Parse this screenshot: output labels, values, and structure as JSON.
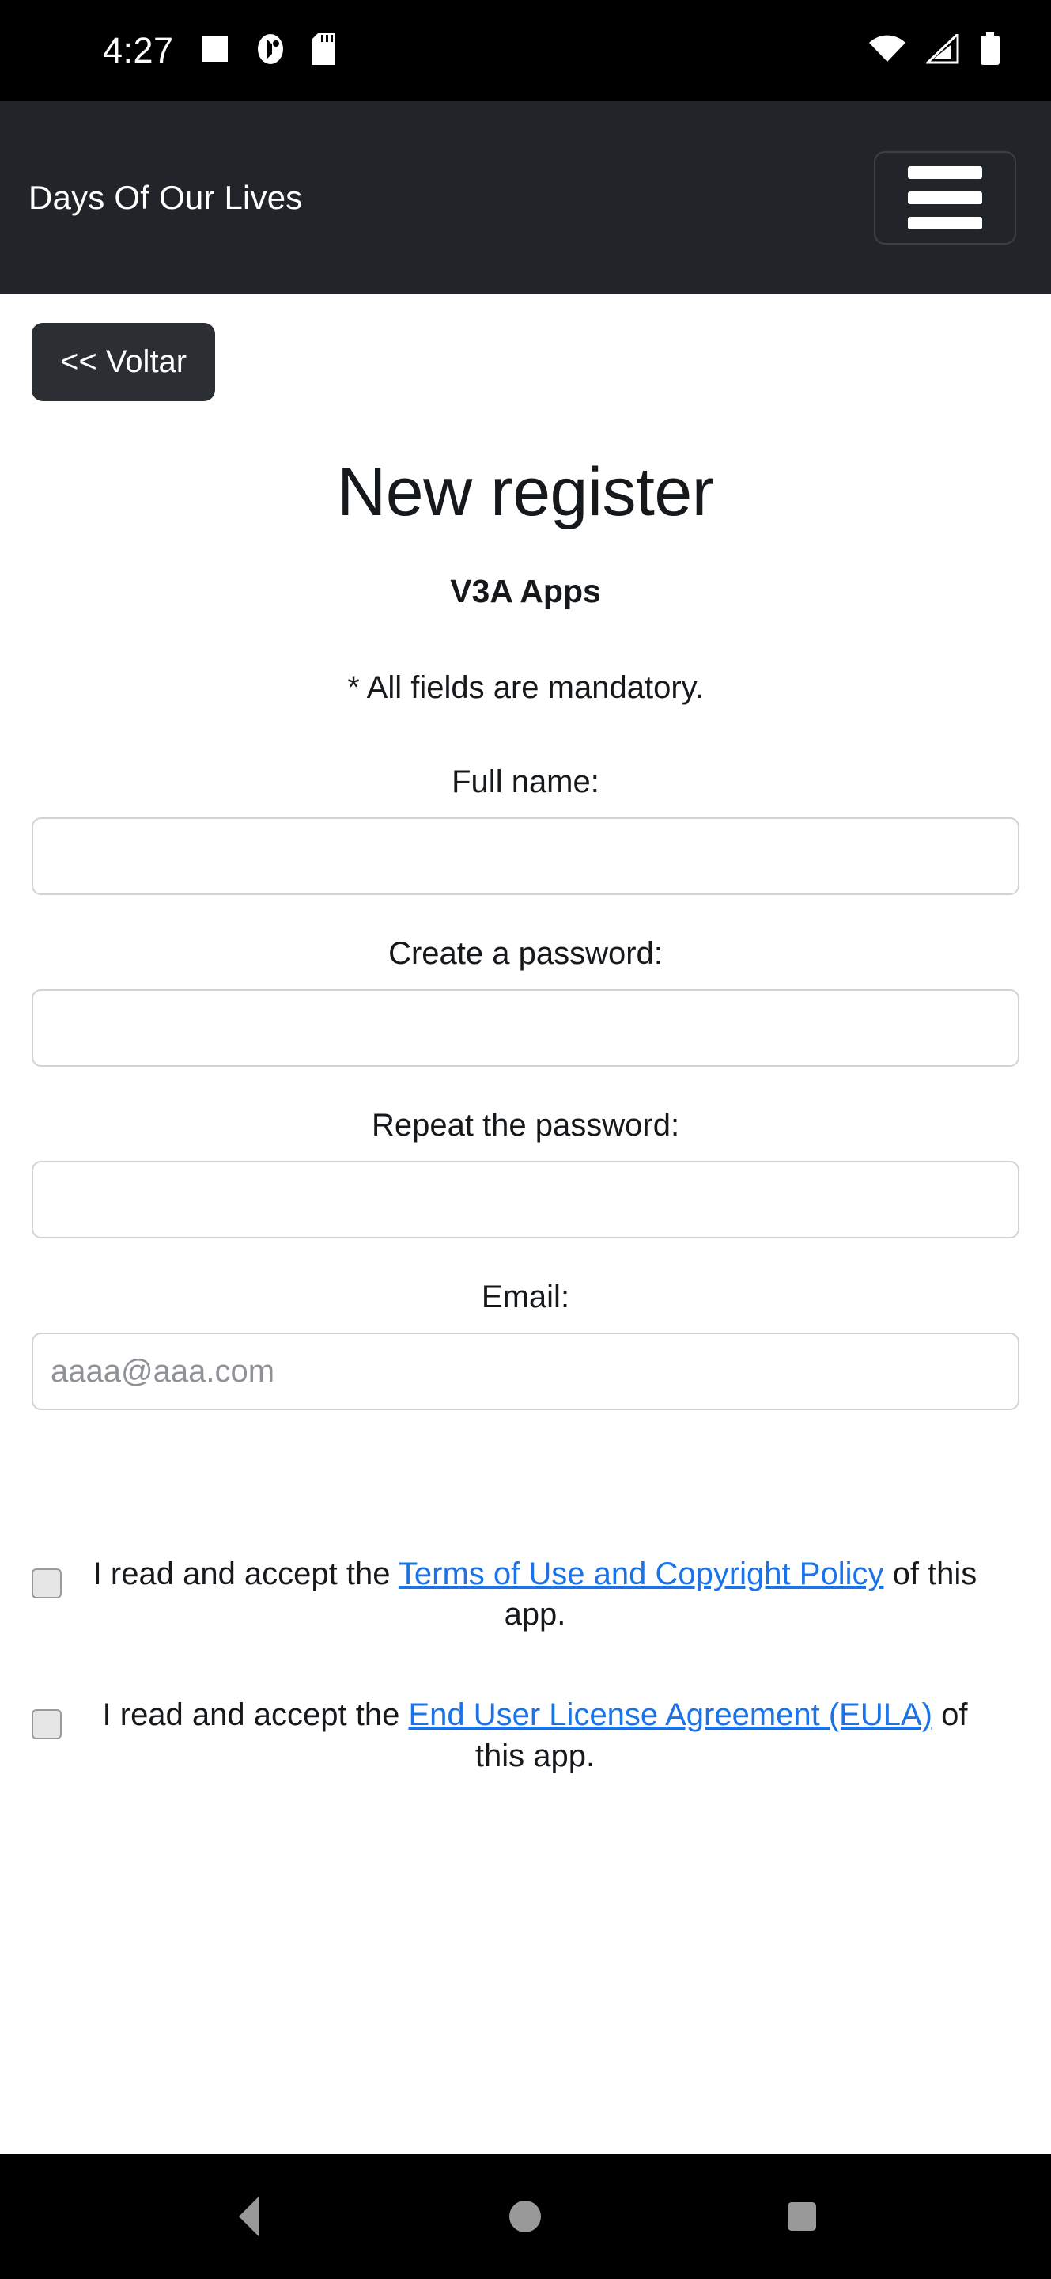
{
  "status_bar": {
    "clock": "4:27",
    "left_icons": [
      "square-notification-icon",
      "app-badge-icon",
      "sd-card-icon"
    ],
    "right_icons": [
      "wifi-icon",
      "cellular-signal-icon",
      "battery-icon"
    ]
  },
  "header": {
    "title": "Days Of Our Lives",
    "menu_label": "menu"
  },
  "toolbar": {
    "back_label": "<< Voltar"
  },
  "page": {
    "title": "New register",
    "subtitle": "V3A Apps",
    "mandatory_note": "* All fields are mandatory."
  },
  "form": {
    "fields": [
      {
        "label": "Full name:",
        "value": "",
        "placeholder": ""
      },
      {
        "label": "Create a password:",
        "value": "",
        "placeholder": ""
      },
      {
        "label": "Repeat the password:",
        "value": "",
        "placeholder": ""
      },
      {
        "label": "Email:",
        "value": "",
        "placeholder": "aaaa@aaa.com"
      }
    ]
  },
  "consent": {
    "items": [
      {
        "prefix": "I read and accept the ",
        "link": "Terms of Use and Copyright Policy",
        "suffix": " of this app.",
        "checked": false
      },
      {
        "prefix": "I read and accept the ",
        "link": "End User License Agreement (EULA)",
        "suffix": " of this app.",
        "checked": false
      }
    ]
  },
  "nav_bar": {
    "back_label": "back",
    "home_label": "home",
    "recents_label": "recents"
  },
  "colors": {
    "header_bg": "#212529",
    "link": "#1a73e8",
    "input_border": "#ced4da",
    "nav_icon": "#999999"
  }
}
